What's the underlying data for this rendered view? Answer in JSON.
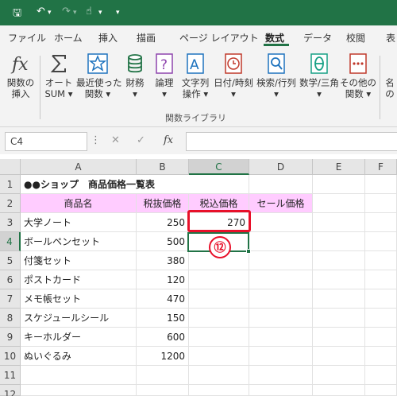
{
  "title_bar": {
    "save_glyph": "🖫",
    "undo_glyph": "↶",
    "redo_glyph": "↷",
    "touch_glyph": "☝",
    "more_glyph": "▾"
  },
  "tabs": [
    "ファイル",
    "ホーム",
    "挿入",
    "描画",
    "ページ レイアウト",
    "数式",
    "データ",
    "校閲",
    "表"
  ],
  "active_tab": "数式",
  "ribbon": {
    "buttons": [
      {
        "icon": "fx-icon",
        "label1": "関数の",
        "label2": "挿入"
      },
      {
        "icon": "sigma-icon",
        "label1": "オート",
        "label2": "SUM ▾"
      },
      {
        "icon": "star-icon",
        "label1": "最近使った",
        "label2": "関数 ▾"
      },
      {
        "icon": "database-icon",
        "label1": "財務",
        "label2": "▾"
      },
      {
        "icon": "question-icon",
        "label1": "論理",
        "label2": "▾"
      },
      {
        "icon": "text-icon",
        "label1": "文字列",
        "label2": "操作 ▾"
      },
      {
        "icon": "clock-icon",
        "label1": "日付/時刻",
        "label2": "▾"
      },
      {
        "icon": "search-icon",
        "label1": "検索/行列",
        "label2": "▾"
      },
      {
        "icon": "theta-icon",
        "label1": "数学/三角",
        "label2": "▾"
      },
      {
        "icon": "more-functions-icon",
        "label1": "その他の",
        "label2": "関数 ▾"
      },
      {
        "icon": "name-icon",
        "label1": "名",
        "label2": "の"
      }
    ],
    "group_label": "関数ライブラリ"
  },
  "formula_bar": {
    "name_box": "C4",
    "cancel": "✕",
    "enter": "✓",
    "fx": "fx",
    "value": ""
  },
  "columns": [
    "A",
    "B",
    "C",
    "D",
    "E",
    "F"
  ],
  "rows": [
    "1",
    "2",
    "3",
    "4",
    "5",
    "6",
    "7",
    "8",
    "9",
    "10",
    "11",
    "12"
  ],
  "sheet": {
    "title": "●●ショップ　商品価格一覧表",
    "headers": [
      "商品名",
      "税抜価格",
      "税込価格",
      "セール価格"
    ],
    "items": [
      {
        "name": "大学ノート",
        "price": "250",
        "tax": "270"
      },
      {
        "name": "ボールペンセット",
        "price": "500",
        "tax": ""
      },
      {
        "name": "付箋セット",
        "price": "380",
        "tax": ""
      },
      {
        "name": "ポストカード",
        "price": "120",
        "tax": ""
      },
      {
        "name": "メモ帳セット",
        "price": "470",
        "tax": ""
      },
      {
        "name": "スケジュールシール",
        "price": "150",
        "tax": ""
      },
      {
        "name": "キーホルダー",
        "price": "600",
        "tax": ""
      },
      {
        "name": "ぬいぐるみ",
        "price": "1200",
        "tax": ""
      }
    ]
  },
  "annotation": {
    "badge": "⑫"
  },
  "colors": {
    "accent": "#217346",
    "header_fill": "#ffccff",
    "callout": "#e8102a"
  }
}
